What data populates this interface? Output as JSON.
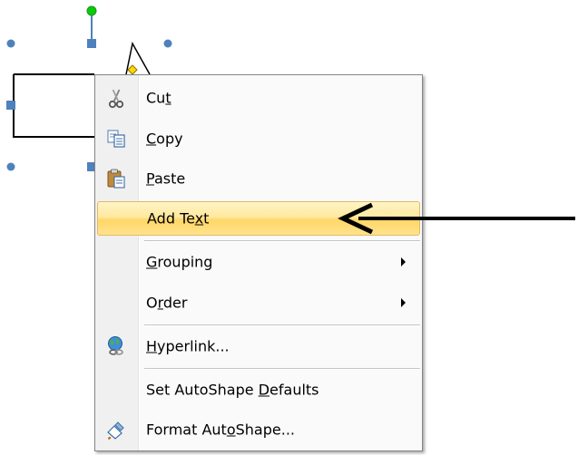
{
  "context_menu": {
    "items": [
      {
        "label_pre": "Cu",
        "label_mnemonic": "t",
        "label_post": "",
        "icon": "scissors-icon"
      },
      {
        "label_pre": "",
        "label_mnemonic": "C",
        "label_post": "opy",
        "icon": "copy-icon"
      },
      {
        "label_pre": "",
        "label_mnemonic": "P",
        "label_post": "aste",
        "icon": "paste-icon"
      },
      {
        "label_pre": "Add Te",
        "label_mnemonic": "x",
        "label_post": "t",
        "icon": ""
      },
      {
        "label_pre": "",
        "label_mnemonic": "G",
        "label_post": "rouping",
        "icon": ""
      },
      {
        "label_pre": "O",
        "label_mnemonic": "r",
        "label_post": "der",
        "icon": ""
      },
      {
        "label_pre": "",
        "label_mnemonic": "H",
        "label_post": "yperlink...",
        "icon": "hyperlink-globe-icon"
      },
      {
        "label_pre": "Set AutoShape ",
        "label_mnemonic": "D",
        "label_post": "efaults",
        "icon": ""
      },
      {
        "label_pre": "Format Aut",
        "label_mnemonic": "o",
        "label_post": "Shape...",
        "icon": "format-shape-icon"
      }
    ],
    "highlighted_item": "Add Text",
    "colors": {
      "highlight_top": "#fff4c5",
      "highlight_bottom": "#ffd767",
      "highlight_border": "#e3b964",
      "gutter": "#f0f0f0"
    }
  },
  "shape": {
    "type": "callout",
    "handle_color_square": "#4f81bd",
    "rotation_handle_color": "#00c000",
    "adjust_handle_color": "#ffd700"
  }
}
